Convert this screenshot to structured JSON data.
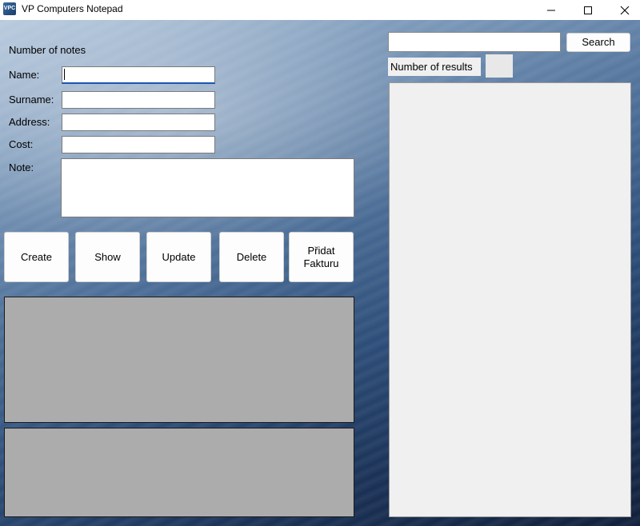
{
  "window": {
    "title": "VP Computers Notepad",
    "icon_text": "VPC"
  },
  "form": {
    "notes_count_label": "Number of notes",
    "name_label": "Name:",
    "surname_label": "Surname:",
    "address_label": "Address:",
    "cost_label": "Cost:",
    "note_label": "Note:",
    "name_value": "",
    "surname_value": "",
    "address_value": "",
    "cost_value": "",
    "note_value": ""
  },
  "buttons": {
    "create": "Create",
    "show": "Show",
    "update": "Update",
    "delete": "Delete",
    "add_invoice_line1": "Přidat",
    "add_invoice_line2": "Fakturu"
  },
  "search": {
    "query": "",
    "button_label": "Search",
    "results_label": "Number of results",
    "results_count": ""
  },
  "colors": {
    "focus_accent": "#1a56b0",
    "gray_panel": "#acacac",
    "results_panel": "#f0f0f0"
  }
}
